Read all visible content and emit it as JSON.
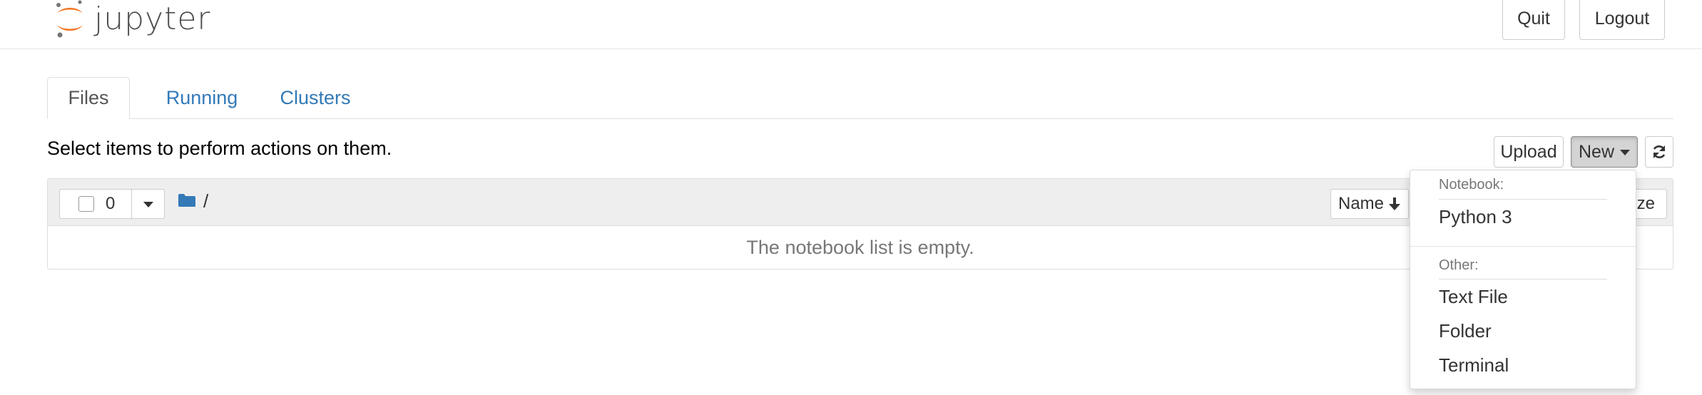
{
  "header": {
    "logo_text": "jupyter",
    "quit_label": "Quit",
    "logout_label": "Logout",
    "brand_orange": "#f37726",
    "brand_gray": "#767677"
  },
  "tabs": [
    {
      "label": "Files",
      "active": true
    },
    {
      "label": "Running",
      "active": false
    },
    {
      "label": "Clusters",
      "active": false
    }
  ],
  "toolbar": {
    "hint": "Select items to perform actions on them.",
    "upload_label": "Upload",
    "new_label": "New",
    "refresh_icon": "refresh-icon"
  },
  "list": {
    "selected_count": "0",
    "breadcrumb": "/",
    "sort_label": "Name",
    "sort_icon": "arrow-down-icon",
    "size_label": "ze",
    "empty_message": "The notebook list is empty."
  },
  "new_menu": {
    "notebook_header": "Notebook:",
    "notebook_items": [
      "Python 3"
    ],
    "other_header": "Other:",
    "other_items": [
      "Text File",
      "Folder",
      "Terminal"
    ]
  },
  "colors": {
    "link": "#337ab7",
    "folder": "#337ab7",
    "header_bg": "#eeeeee"
  }
}
